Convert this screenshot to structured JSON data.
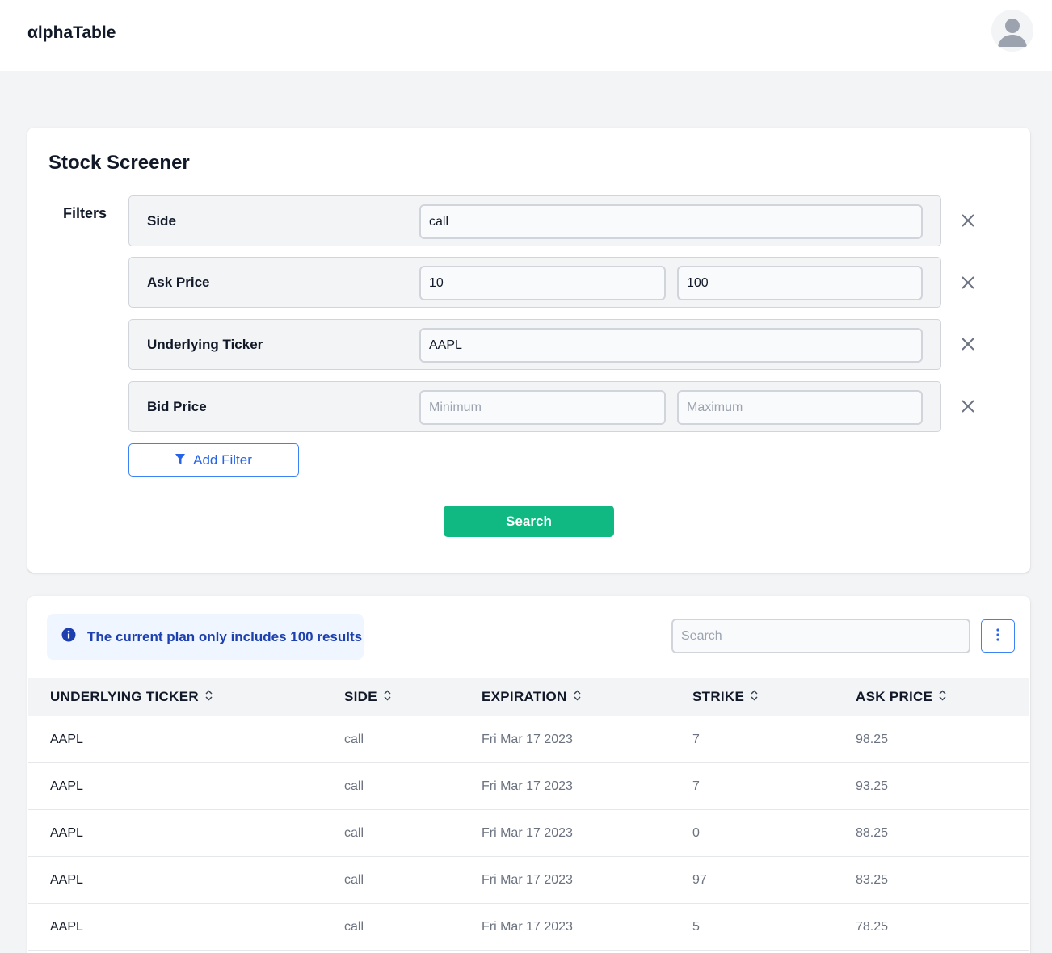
{
  "app": {
    "logo": "αlphaTable"
  },
  "screener": {
    "title": "Stock Screener",
    "filters_label": "Filters",
    "filters": [
      {
        "name": "Side",
        "value": "call"
      },
      {
        "name": "Ask Price",
        "min_value": "10",
        "max_value": "100"
      },
      {
        "name": "Underlying Ticker",
        "value": "AAPL"
      },
      {
        "name": "Bid Price",
        "min_value": "",
        "max_value": "",
        "min_placeholder": "Minimum",
        "max_placeholder": "Maximum"
      }
    ],
    "add_filter_label": "Add Filter",
    "search_label": "Search"
  },
  "results": {
    "plan_notice": "The current plan only includes 100 results",
    "search_placeholder": "Search",
    "columns": [
      "UNDERLYING TICKER",
      "SIDE",
      "EXPIRATION",
      "STRIKE",
      "ASK PRICE"
    ],
    "rows": [
      [
        "AAPL",
        "call",
        "Fri Mar 17 2023",
        "7",
        "98.25"
      ],
      [
        "AAPL",
        "call",
        "Fri Mar 17 2023",
        "7",
        "93.25"
      ],
      [
        "AAPL",
        "call",
        "Fri Mar 17 2023",
        "0",
        "88.25"
      ],
      [
        "AAPL",
        "call",
        "Fri Mar 17 2023",
        "97",
        "83.25"
      ],
      [
        "AAPL",
        "call",
        "Fri Mar 17 2023",
        "5",
        "78.25"
      ]
    ]
  },
  "colors": {
    "accent_blue": "#2563eb",
    "search_green": "#10b981",
    "notice_bg": "#eff6ff",
    "notice_text": "#1e40af"
  },
  "icons": {
    "avatar": "user-avatar-icon",
    "remove": "close-icon",
    "add_filter": "filter-icon",
    "notice": "info-icon",
    "menu": "vertical-dots-icon",
    "sort": "sort-icon"
  }
}
